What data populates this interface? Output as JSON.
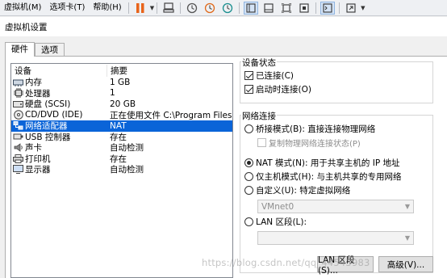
{
  "menubar": {
    "items": [
      "虚拟机(M)",
      "选项卡(T)",
      "帮助(H)"
    ]
  },
  "toolbar": {
    "icons": [
      "pause-icon",
      "send-keys-icon",
      "snapshot-icon",
      "revert-snapshot-icon",
      "snapshot-manager-icon",
      "view-normal-icon",
      "view-console-icon",
      "fit-guest-icon",
      "fit-window-icon",
      "terminal-icon",
      "fullscreen-icon"
    ]
  },
  "dialog": {
    "title": "虚拟机设置",
    "tabs": [
      "硬件",
      "选项"
    ],
    "columns": {
      "device": "设备",
      "summary": "摘要"
    },
    "devices": [
      {
        "name": "内存",
        "summary": "1 GB",
        "icon": "memory-icon"
      },
      {
        "name": "处理器",
        "summary": "1",
        "icon": "cpu-icon"
      },
      {
        "name": "硬盘 (SCSI)",
        "summary": "20 GB",
        "icon": "harddisk-icon"
      },
      {
        "name": "CD/DVD (IDE)",
        "summary": "正在使用文件 C:\\Program Files ...",
        "icon": "cdrom-icon"
      },
      {
        "name": "网络适配器",
        "summary": "NAT",
        "icon": "network-icon"
      },
      {
        "name": "USB 控制器",
        "summary": "存在",
        "icon": "usb-icon"
      },
      {
        "name": "声卡",
        "summary": "自动检测",
        "icon": "sound-icon"
      },
      {
        "name": "打印机",
        "summary": "存在",
        "icon": "printer-icon"
      },
      {
        "name": "显示器",
        "summary": "自动检测",
        "icon": "display-icon"
      }
    ],
    "selected_index": 4,
    "device_status": {
      "title": "设备状态",
      "connected": "已连接(C)",
      "connect_at_power_on": "启动时连接(O)"
    },
    "network": {
      "title": "网络连接",
      "bridged": "桥接模式(B): 直接连接物理网络",
      "replicate": "复制物理网络连接状态(P)",
      "nat": "NAT 模式(N): 用于共享主机的 IP 地址",
      "host_only": "仅主机模式(H): 与主机共享的专用网络",
      "custom": "自定义(U): 特定虚拟网络",
      "custom_value": "VMnet0",
      "lan_segment": "LAN 区段(L):",
      "lan_value": ""
    },
    "buttons": {
      "lan_segments": "LAN 区段(S)...",
      "advanced": "高级(V)..."
    },
    "watermark": "https://blog.csdn.net/qq_44543983"
  }
}
